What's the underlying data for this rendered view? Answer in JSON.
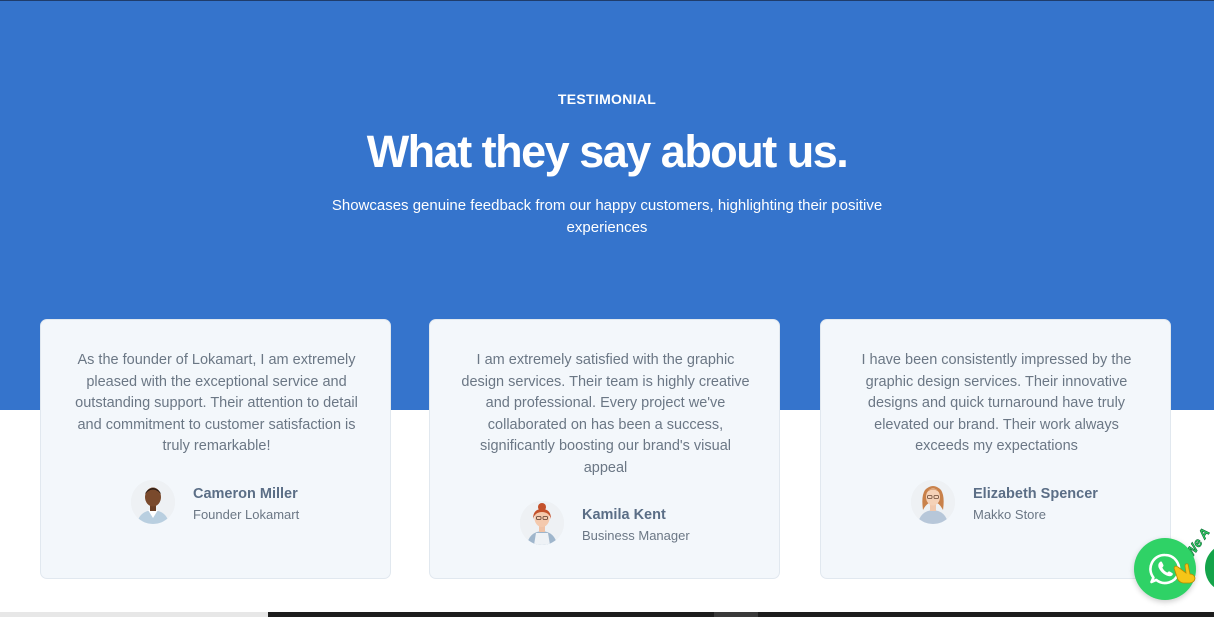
{
  "section": {
    "eyebrow": "TESTIMONIAL",
    "title": "What they say about us.",
    "subtitle": "Showcases genuine feedback from our happy customers, highlighting their positive experiences"
  },
  "testimonials": [
    {
      "quote": "As the founder of Lokamart, I am extremely pleased with the exceptional service and outstanding support. Their attention to detail and commitment to customer satisfaction is truly remarkable!",
      "name": "Cameron Miller",
      "role": "Founder Lokamart"
    },
    {
      "quote": "I am extremely satisfied with the graphic design services. Their team is highly creative and professional. Every project we've collaborated on has been a success, significantly boosting our brand's visual appeal",
      "name": "Kamila Kent",
      "role": "Business Manager"
    },
    {
      "quote": "I have been consistently impressed by the graphic design services. Their innovative designs and quick turnaround have truly elevated our brand. Their work always exceeds my expectations",
      "name": "Elizabeth Spencer",
      "role": "Makko Store"
    }
  ],
  "whatsapp": {
    "sticker_text": "We A"
  },
  "colors": {
    "hero": "#3574cc",
    "card": "#f3f7fb",
    "whatsapp": "#2fd266"
  }
}
